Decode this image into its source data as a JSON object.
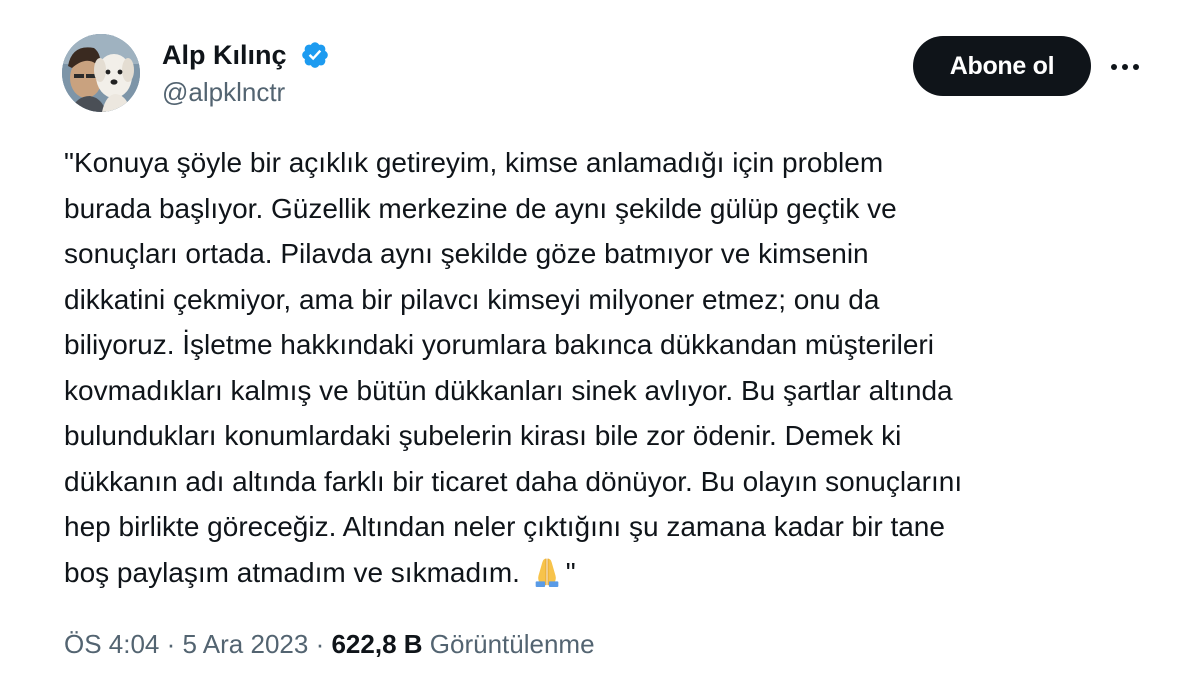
{
  "author": {
    "display_name": "Alp Kılınç",
    "handle": "@alpklnctr",
    "verified": true,
    "verified_color": "#1d9bf0"
  },
  "actions": {
    "follow_label": "Abone ol",
    "more_icon": "more-horizontal-icon"
  },
  "tweet": {
    "lines": [
      "\"Konuya şöyle bir açıklık getireyim, kimse anlamadığı için problem",
      "burada başlıyor. Güzellik merkezine de aynı şekilde gülüp geçtik ve",
      "sonuçları ortada. Pilavda aynı şekilde göze batmıyor ve kimsenin",
      "dikkatini çekmiyor, ama bir pilavcı kimseyi milyoner etmez; onu da",
      "biliyoruz. İşletme hakkındaki yorumlara bakınca dükkandan müşterileri",
      "kovmadıkları kalmış ve bütün dükkanları sinek avlıyor. Bu şartlar altında",
      "bulundukları konumlardaki şubelerin kirası bile zor ödenir. Demek ki",
      "dükkanın adı altında farklı bir ticaret daha dönüyor. Bu olayın sonuçlarını",
      "hep birlikte göreceğiz. Altından neler çıktığını şu zamana kadar bir tane",
      "boş paylaşım atmadım ve sıkmadım."
    ],
    "closing": "\"",
    "emoji": "folded-hands-icon"
  },
  "meta": {
    "time": "ÖS 4:04",
    "separator": "·",
    "date": "5 Ara 2023",
    "views_count": "622,8 B",
    "views_label": "Görüntülenme"
  },
  "colors": {
    "text": "#0f1419",
    "secondary": "#536471",
    "button_bg": "#0f1419",
    "button_text": "#ffffff"
  }
}
